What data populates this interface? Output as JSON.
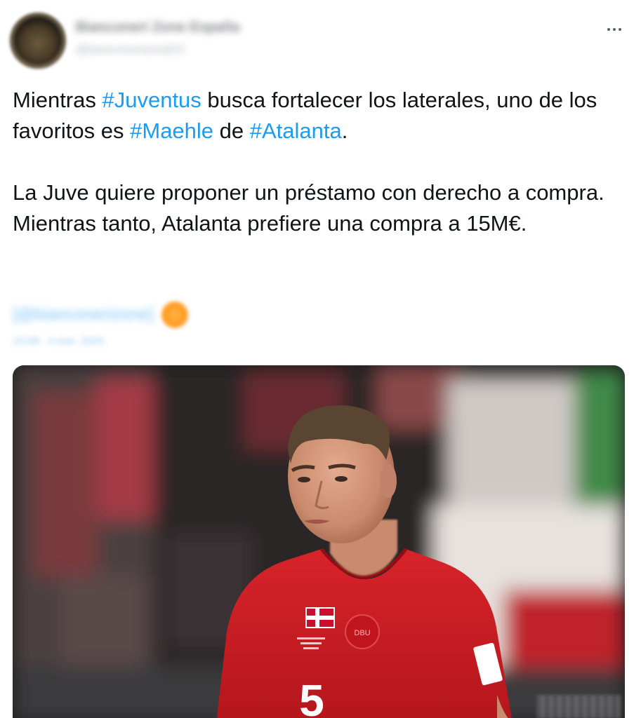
{
  "tweet": {
    "author": {
      "display_name": "Bianconeri Zone España",
      "handle": "@bianconerizoneES"
    },
    "text": {
      "line1_prefix": "Mientras ",
      "hashtag_juventus": "#Juventus",
      "line1_middle": " busca fortalecer los laterales, uno de los favoritos es ",
      "hashtag_maehle": "#Maehle",
      "line1_de": " de ",
      "hashtag_atalanta": "#Atalanta",
      "line1_end": ".",
      "paragraph2": "La Juve quiere proponer un préstamo con derecho a compra. Mientras tanto, Atalanta prefiere una compra a 15M€."
    },
    "signature": {
      "handle": "[@bianconerizone]",
      "meta": "15:09 · 4 ene. 2023"
    },
    "media": {
      "jersey_number": "5",
      "badge_text": "DBU"
    }
  },
  "colors": {
    "hashtag": "#1d9bf0",
    "text": "#0f1419",
    "secondary": "#536471",
    "jersey_red": "#d2191f"
  },
  "icons": {
    "more": "more-horizontal-icon",
    "verified": "orange-badge-icon"
  }
}
